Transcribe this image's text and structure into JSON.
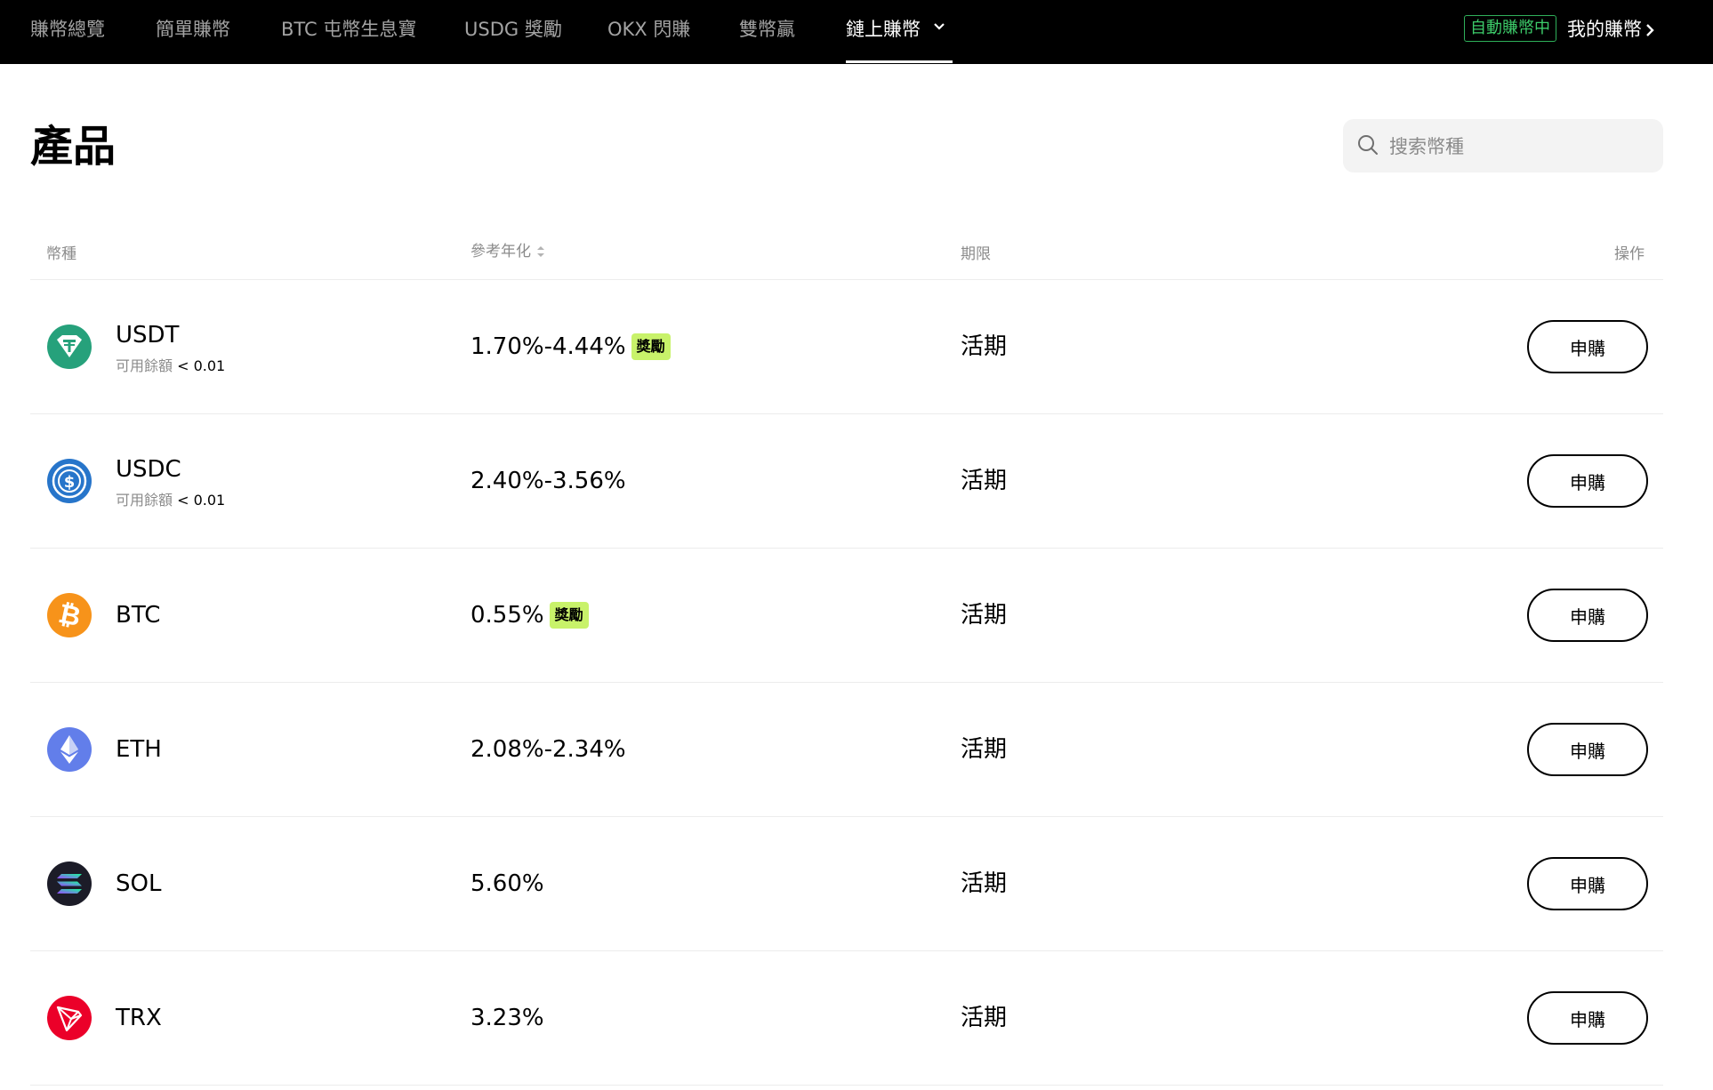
{
  "nav": {
    "tabs": [
      {
        "label": "賺幣總覽"
      },
      {
        "label": "簡單賺幣"
      },
      {
        "label": "BTC 屯幣生息寶"
      },
      {
        "label": "USDG 獎勵"
      },
      {
        "label": "OKX 閃賺"
      },
      {
        "label": "雙幣贏"
      },
      {
        "label": "鏈上賺幣"
      }
    ],
    "active_tab": "鏈上賺幣",
    "auto_earn_badge": "自動賺幣中",
    "my_earn_label": "我的賺幣"
  },
  "page": {
    "title": "產品",
    "search_placeholder": "搜索幣種"
  },
  "table": {
    "headers": {
      "coin": "幣種",
      "apy": "參考年化",
      "term": "期限",
      "action": "操作"
    },
    "rows": [
      {
        "coin": "USDT",
        "balance_label": "可用餘額",
        "balance_value": "< 0.01",
        "apy": "1.70%-4.44%",
        "bonus": "獎勵",
        "term": "活期",
        "action": "申購",
        "icon": "usdt-icon",
        "color": "#26a17b"
      },
      {
        "coin": "USDC",
        "balance_label": "可用餘額",
        "balance_value": "< 0.01",
        "apy": "2.40%-3.56%",
        "bonus": "",
        "term": "活期",
        "action": "申購",
        "icon": "usdc-icon",
        "color": "#2775ca"
      },
      {
        "coin": "BTC",
        "balance_label": "",
        "balance_value": "",
        "apy": "0.55%",
        "bonus": "獎勵",
        "term": "活期",
        "action": "申購",
        "icon": "btc-icon",
        "color": "#f7931a"
      },
      {
        "coin": "ETH",
        "balance_label": "",
        "balance_value": "",
        "apy": "2.08%-2.34%",
        "bonus": "",
        "term": "活期",
        "action": "申購",
        "icon": "eth-icon",
        "color": "#627eea"
      },
      {
        "coin": "SOL",
        "balance_label": "",
        "balance_value": "",
        "apy": "5.60%",
        "bonus": "",
        "term": "活期",
        "action": "申購",
        "icon": "sol-icon",
        "color": "#1c1c28"
      },
      {
        "coin": "TRX",
        "balance_label": "",
        "balance_value": "",
        "apy": "3.23%",
        "bonus": "",
        "term": "活期",
        "action": "申購",
        "icon": "trx-icon",
        "color": "#eb0029"
      }
    ]
  }
}
